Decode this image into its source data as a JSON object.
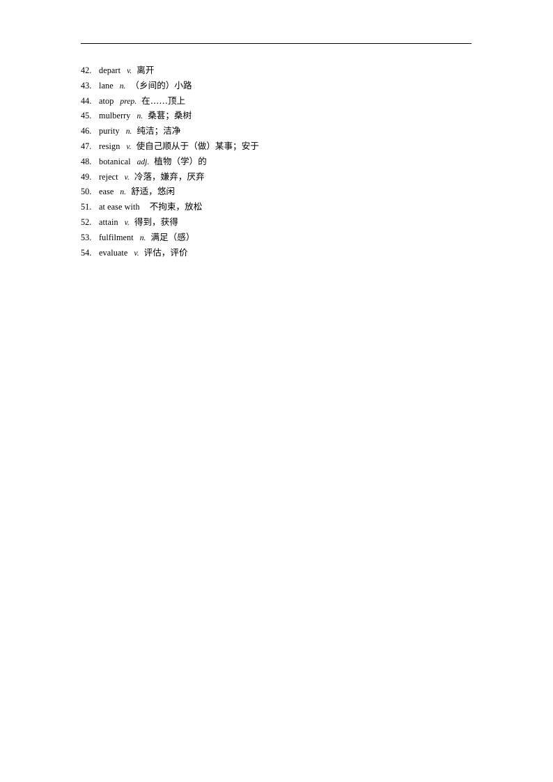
{
  "document": {
    "type": "vocabulary-list",
    "page_background": "#ffffff",
    "text_color": "#000000",
    "header_rule": {
      "present": true,
      "color": "#000000"
    },
    "entries": [
      {
        "number": "42.",
        "word": "depart",
        "pos": "v.",
        "definition": "离开"
      },
      {
        "number": "43.",
        "word": "lane",
        "pos": "n.",
        "definition": "（乡间的）小路"
      },
      {
        "number": "44.",
        "word": "atop",
        "pos": "prep.",
        "definition": "在……顶上"
      },
      {
        "number": "45.",
        "word": "mulberry",
        "pos": "n.",
        "definition": "桑葚；桑树"
      },
      {
        "number": "46.",
        "word": "purity",
        "pos": "n.",
        "definition": "纯洁；洁净"
      },
      {
        "number": "47.",
        "word": "resign",
        "pos": "v.",
        "definition": "使自己顺从于（做）某事；安于"
      },
      {
        "number": "48.",
        "word": "botanical",
        "pos": "adj.",
        "definition": "植物（学）的"
      },
      {
        "number": "49.",
        "word": "reject",
        "pos": "v.",
        "definition": "冷落，嫌弃，厌弃"
      },
      {
        "number": "50.",
        "word": "ease",
        "pos": "n.",
        "definition": "舒适，悠闲"
      },
      {
        "number": "51.",
        "word": "at ease with",
        "pos": "",
        "definition": "不拘束，放松"
      },
      {
        "number": "52.",
        "word": "attain",
        "pos": "v.",
        "definition": "得到，获得"
      },
      {
        "number": "53.",
        "word": "fulfilment",
        "pos": "n.",
        "definition": "满足（感）"
      },
      {
        "number": "54.",
        "word": "evaluate",
        "pos": "v.",
        "definition": "评估，评价"
      }
    ]
  }
}
